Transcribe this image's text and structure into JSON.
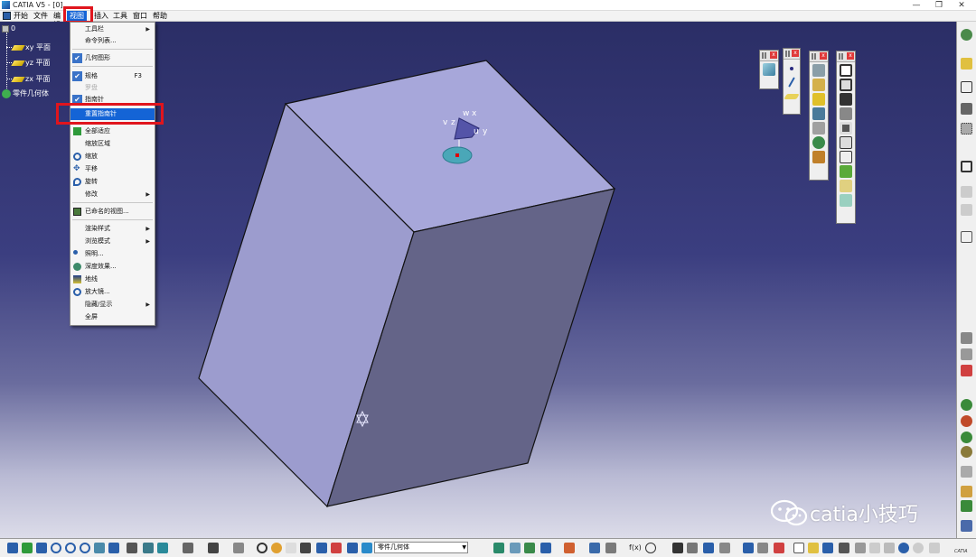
{
  "window": {
    "title": "CATIA V5 - [0]",
    "min": "—",
    "restore": "❐",
    "close": "✕"
  },
  "menu": {
    "items": [
      "开始",
      "文件",
      "编辑",
      "视图",
      "插入",
      "工具",
      "窗口",
      "帮助"
    ],
    "active": "视图"
  },
  "tree": {
    "root": "0",
    "items": [
      "xy 平面",
      "yz 平面",
      "zx 平面",
      "零件几何体"
    ]
  },
  "view_menu": {
    "items": [
      {
        "label": "工具栏",
        "submenu": true
      },
      {
        "label": "命令列表..."
      },
      {
        "label": "几何图形",
        "checked": true
      },
      {
        "label": "规格",
        "checked": true,
        "shortcut": "F3"
      },
      {
        "label": "罗盘",
        "checked": false,
        "disabled": true
      },
      {
        "label": "指南针",
        "checked": true
      },
      {
        "label": "重置指南针",
        "selected": true
      },
      {
        "label": "全部适应"
      },
      {
        "label": "缩放区域"
      },
      {
        "label": "缩放"
      },
      {
        "label": "平移"
      },
      {
        "label": "旋转"
      },
      {
        "label": "修改",
        "submenu": true
      },
      {
        "label": "已命名的视图..."
      },
      {
        "label": "渲染样式",
        "submenu": true
      },
      {
        "label": "浏览模式",
        "submenu": true
      },
      {
        "label": "照明..."
      },
      {
        "label": "深度效果..."
      },
      {
        "label": "地线"
      },
      {
        "label": "放大镜..."
      },
      {
        "label": "隐藏/显示",
        "submenu": true
      },
      {
        "label": "全屏"
      }
    ]
  },
  "compass": {
    "labels": [
      "w",
      "x",
      "v",
      "z",
      "u",
      "y"
    ]
  },
  "bottom": {
    "part_select": "零件几何体"
  },
  "watermark": {
    "text": "catia小技巧"
  },
  "logo": {
    "text": "CATIA"
  },
  "colors": {
    "highlight": "#1464d6",
    "red_box": "#e0151d",
    "part_face_top": "#a6a6d8",
    "part_face_left": "#9a9acc",
    "part_face_front": "#636387"
  }
}
